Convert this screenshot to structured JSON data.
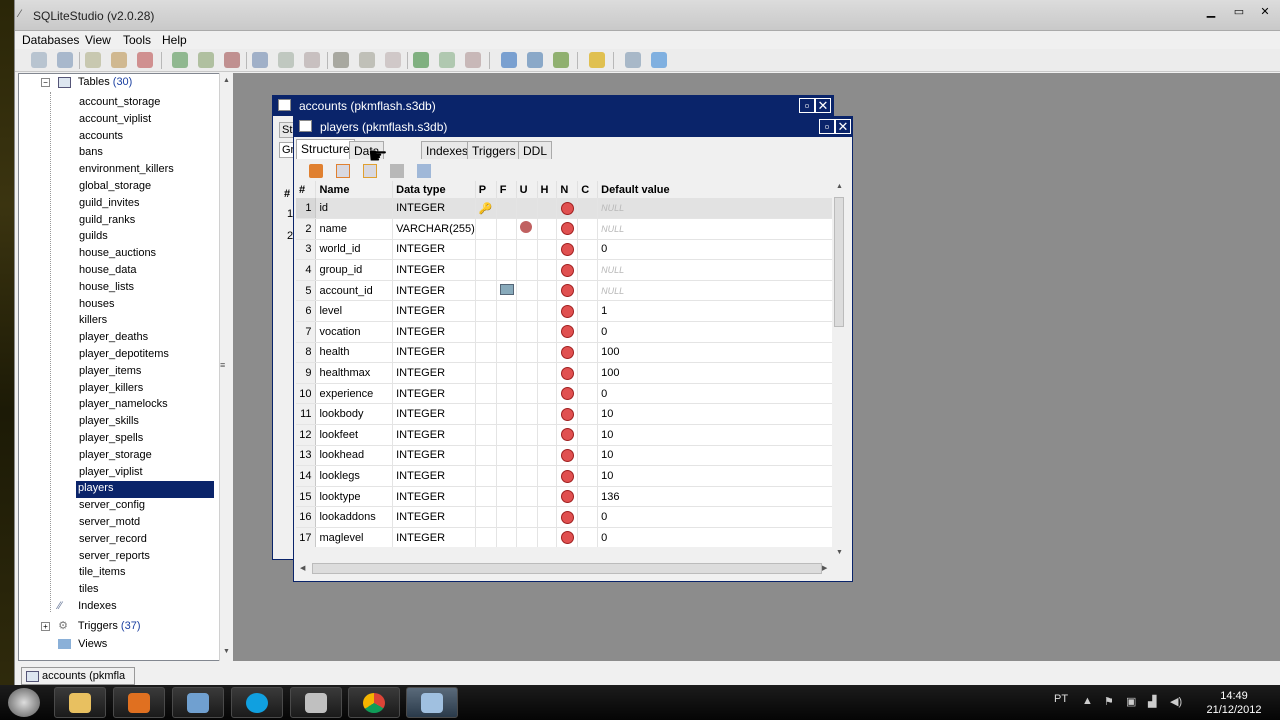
{
  "app": {
    "title": "SQLiteStudio (v2.0.28)"
  },
  "menu": [
    "Databases",
    "View",
    "Tools",
    "Help"
  ],
  "tree": {
    "tables_label": "Tables",
    "tables_count": "(30)",
    "tables": [
      "account_storage",
      "account_viplist",
      "accounts",
      "bans",
      "environment_killers",
      "global_storage",
      "guild_invites",
      "guild_ranks",
      "guilds",
      "house_auctions",
      "house_data",
      "house_lists",
      "houses",
      "killers",
      "player_deaths",
      "player_depotitems",
      "player_items",
      "player_killers",
      "player_namelocks",
      "player_skills",
      "player_spells",
      "player_storage",
      "player_viplist",
      "players",
      "server_config",
      "server_motd",
      "server_record",
      "server_reports",
      "tile_items",
      "tiles"
    ],
    "selected": "players",
    "indexes_label": "Indexes",
    "triggers_label": "Triggers",
    "triggers_count": "(37)",
    "views_label": "Views"
  },
  "back_window": {
    "title": "accounts (pkmflash.s3db)",
    "tab_partial_1": "Str",
    "tab_partial_2": "Gr",
    "col_hash": "#",
    "rows": [
      "1",
      "2"
    ]
  },
  "front_window": {
    "title": "players (pkmflash.s3db)",
    "tabs": [
      "Structure",
      "Data",
      "Indexes",
      "Triggers",
      "DDL"
    ],
    "active_tab": "Structure",
    "columns": [
      "#",
      "Name",
      "Data type",
      "P",
      "F",
      "U",
      "H",
      "N",
      "C",
      "Default value"
    ],
    "rows": [
      {
        "n": "1",
        "name": "id",
        "type": "INTEGER",
        "p": true,
        "f": false,
        "u": false,
        "nn": true,
        "def": "NULL",
        "null": true
      },
      {
        "n": "2",
        "name": "name",
        "type": "VARCHAR(255)",
        "p": false,
        "f": false,
        "u": true,
        "nn": true,
        "def": "NULL",
        "null": true
      },
      {
        "n": "3",
        "name": "world_id",
        "type": "INTEGER",
        "p": false,
        "f": false,
        "u": false,
        "nn": true,
        "def": "0",
        "null": false
      },
      {
        "n": "4",
        "name": "group_id",
        "type": "INTEGER",
        "p": false,
        "f": false,
        "u": false,
        "nn": true,
        "def": "NULL",
        "null": true
      },
      {
        "n": "5",
        "name": "account_id",
        "type": "INTEGER",
        "p": false,
        "f": true,
        "u": false,
        "nn": true,
        "def": "NULL",
        "null": true
      },
      {
        "n": "6",
        "name": "level",
        "type": "INTEGER",
        "p": false,
        "f": false,
        "u": false,
        "nn": true,
        "def": "1",
        "null": false
      },
      {
        "n": "7",
        "name": "vocation",
        "type": "INTEGER",
        "p": false,
        "f": false,
        "u": false,
        "nn": true,
        "def": "0",
        "null": false
      },
      {
        "n": "8",
        "name": "health",
        "type": "INTEGER",
        "p": false,
        "f": false,
        "u": false,
        "nn": true,
        "def": "100",
        "null": false
      },
      {
        "n": "9",
        "name": "healthmax",
        "type": "INTEGER",
        "p": false,
        "f": false,
        "u": false,
        "nn": true,
        "def": "100",
        "null": false
      },
      {
        "n": "10",
        "name": "experience",
        "type": "INTEGER",
        "p": false,
        "f": false,
        "u": false,
        "nn": true,
        "def": "0",
        "null": false
      },
      {
        "n": "11",
        "name": "lookbody",
        "type": "INTEGER",
        "p": false,
        "f": false,
        "u": false,
        "nn": true,
        "def": "10",
        "null": false
      },
      {
        "n": "12",
        "name": "lookfeet",
        "type": "INTEGER",
        "p": false,
        "f": false,
        "u": false,
        "nn": true,
        "def": "10",
        "null": false
      },
      {
        "n": "13",
        "name": "lookhead",
        "type": "INTEGER",
        "p": false,
        "f": false,
        "u": false,
        "nn": true,
        "def": "10",
        "null": false
      },
      {
        "n": "14",
        "name": "looklegs",
        "type": "INTEGER",
        "p": false,
        "f": false,
        "u": false,
        "nn": true,
        "def": "10",
        "null": false
      },
      {
        "n": "15",
        "name": "looktype",
        "type": "INTEGER",
        "p": false,
        "f": false,
        "u": false,
        "nn": true,
        "def": "136",
        "null": false
      },
      {
        "n": "16",
        "name": "lookaddons",
        "type": "INTEGER",
        "p": false,
        "f": false,
        "u": false,
        "nn": true,
        "def": "0",
        "null": false
      },
      {
        "n": "17",
        "name": "maglevel",
        "type": "INTEGER",
        "p": false,
        "f": false,
        "u": false,
        "nn": true,
        "def": "0",
        "null": false
      }
    ]
  },
  "task_tab": "accounts (pkmfla",
  "taskbar": {
    "lang": "PT",
    "time": "14:49",
    "date": "21/12/2012"
  }
}
